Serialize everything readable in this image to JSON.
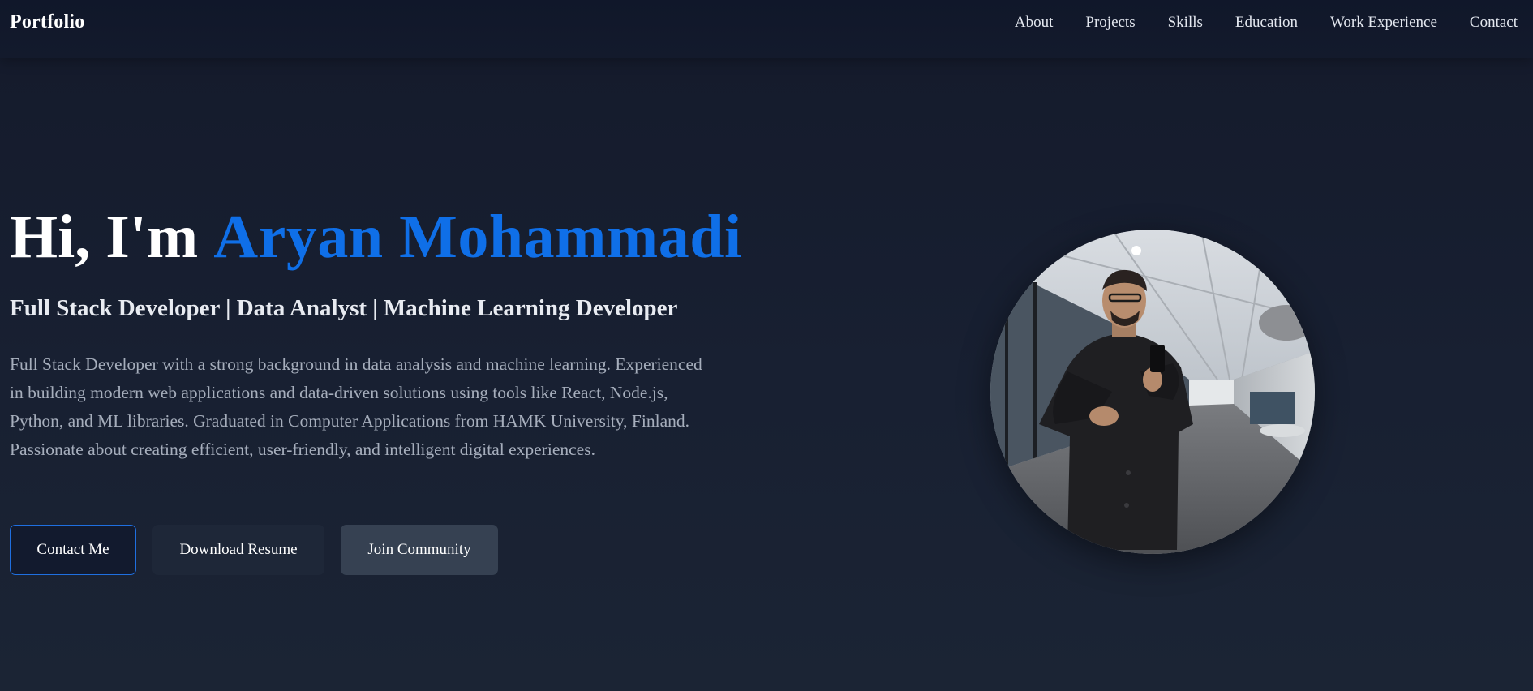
{
  "navbar": {
    "brand": "Portfolio",
    "links": [
      "About",
      "Projects",
      "Skills",
      "Education",
      "Work Experience",
      "Contact"
    ]
  },
  "hero": {
    "greeting": "Hi, I'm",
    "name": "Aryan Mohammadi",
    "subtitle": "Full Stack Developer | Data Analyst | Machine Learning Developer",
    "description": "Full Stack Developer with a strong background in data analysis and machine learning. Experienced in building modern web applications and data-driven solutions using tools like React, Node.js, Python, and ML libraries. Graduated in Computer Applications from HAMK University, Finland. Passionate about creating efficient, user-friendly, and intelligent digital experiences.",
    "buttons": {
      "contact": "Contact Me",
      "resume": "Download Resume",
      "community": "Join Community"
    }
  },
  "colors": {
    "accent": "#0f6fe8",
    "background": "#182032",
    "navbar": "#121a2c"
  }
}
